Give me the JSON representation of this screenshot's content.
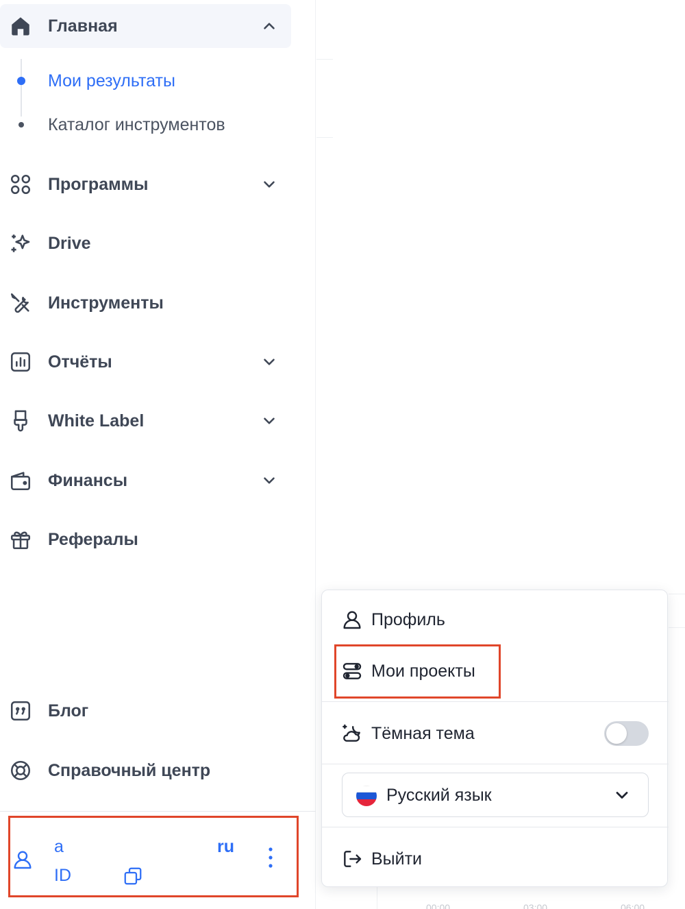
{
  "sidebar": {
    "home": {
      "label": "Главная",
      "icon": "home-icon"
    },
    "sub_items": [
      {
        "label": "Мои результаты",
        "active": true
      },
      {
        "label": "Каталог инструментов",
        "active": false
      }
    ],
    "items": [
      {
        "key": "programs",
        "label": "Программы",
        "icon": "grid-icon",
        "expandable": true
      },
      {
        "key": "drive",
        "label": "Drive",
        "icon": "sparkles-icon",
        "expandable": false
      },
      {
        "key": "tools",
        "label": "Инструменты",
        "icon": "tools-icon",
        "expandable": false
      },
      {
        "key": "reports",
        "label": "Отчёты",
        "icon": "bar-chart-icon",
        "expandable": true
      },
      {
        "key": "white-label",
        "label": "White Label",
        "icon": "brush-icon",
        "expandable": true
      },
      {
        "key": "finance",
        "label": "Финансы",
        "icon": "wallet-icon",
        "expandable": true
      },
      {
        "key": "referrals",
        "label": "Рефералы",
        "icon": "gift-icon",
        "expandable": false
      }
    ],
    "bottom_items": [
      {
        "key": "blog",
        "label": "Блог",
        "icon": "quote-icon"
      },
      {
        "key": "help",
        "label": "Справочный центр",
        "icon": "lifebuoy-icon"
      }
    ],
    "account": {
      "name": "a",
      "id_label": "ID",
      "lang": "ru"
    }
  },
  "menu": {
    "profile": "Профиль",
    "projects": "Мои проекты",
    "dark_theme": "Тёмная тема",
    "dark_theme_on": false,
    "language": "Русский язык",
    "logout": "Выйти"
  },
  "background": {
    "axis_ticks": [
      "00:00",
      "03:00",
      "06:00"
    ]
  },
  "colors": {
    "accent": "#2e6ef6",
    "highlight": "#e0462a",
    "text": "#3f4756"
  }
}
